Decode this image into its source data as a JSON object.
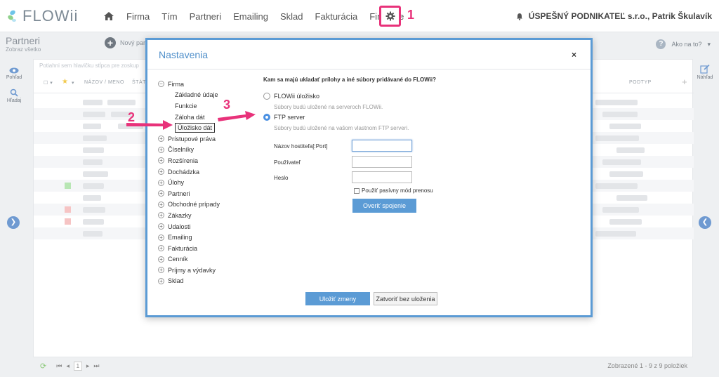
{
  "topbar": {
    "logo": "FLOWii",
    "nav": [
      "Firma",
      "Tím",
      "Partneri",
      "Emailing",
      "Sklad",
      "Fakturácia",
      "Financie"
    ],
    "user": "ÚSPEŠNÝ PODNIKATEĽ s.r.o., Patrik Škulavík"
  },
  "callouts": {
    "one": "1",
    "two": "2",
    "three": "3"
  },
  "page": {
    "title": "Partneri",
    "subtitle": "Zobraz všetko",
    "new_button": "Nový part",
    "help": "Ako na to?",
    "rail_view": "Pohľad",
    "rail_search": "Hľadaj",
    "rail_preview": "Náhľad",
    "grid_hint": "Potiahni sem hlavičku stĺpca pre zoskup",
    "col_name": "NÁZOV / MENO",
    "col_state": "ŠTÁT",
    "col_subtype": "PODTYP",
    "footer_page": "1",
    "footer_count": "Zobrazené 1 - 9 z 9 položiek"
  },
  "modal": {
    "title": "Nastavenia",
    "close": "×",
    "tree": [
      {
        "label": "Firma",
        "toggle": "−",
        "children": [
          "Základné údaje",
          "Funkcie",
          "Záloha dát",
          "Úložisko dát"
        ]
      },
      {
        "label": "Prístupové práva",
        "toggle": "+"
      },
      {
        "label": "Číselníky",
        "toggle": "+"
      },
      {
        "label": "Rozšírenia",
        "toggle": "+"
      },
      {
        "label": "Dochádzka",
        "toggle": "+"
      },
      {
        "label": "Úlohy",
        "toggle": "+"
      },
      {
        "label": "Partneri",
        "toggle": "+"
      },
      {
        "label": "Obchodné prípady",
        "toggle": "+"
      },
      {
        "label": "Zákazky",
        "toggle": "+"
      },
      {
        "label": "Udalosti",
        "toggle": "+"
      },
      {
        "label": "Emailing",
        "toggle": "+"
      },
      {
        "label": "Fakturácia",
        "toggle": "+"
      },
      {
        "label": "Cenník",
        "toggle": "+"
      },
      {
        "label": "Príjmy a výdavky",
        "toggle": "+"
      },
      {
        "label": "Sklad",
        "toggle": "+"
      }
    ],
    "question": "Kam sa majú ukladať prílohy a iné súbory pridávané do FLOWii?",
    "opt_flowii": "FLOWii úložisko",
    "opt_flowii_hint": "Súbory budú uložené na serveroch FLOWii.",
    "opt_ftp": "FTP server",
    "opt_ftp_hint": "Súbory budú uložené na vašom vlastnom FTP serveri.",
    "host_label": "Názov hostiteľa[:Port]",
    "user_label": "Používateľ",
    "pass_label": "Heslo",
    "host_value": "",
    "user_value": "",
    "pass_value": "",
    "passive_label": "Použiť pasívny mód prenosu",
    "verify_btn": "Overiť spojenie",
    "save_btn": "Uložiť zmeny",
    "close_btn": "Zatvoriť bez uloženia"
  }
}
